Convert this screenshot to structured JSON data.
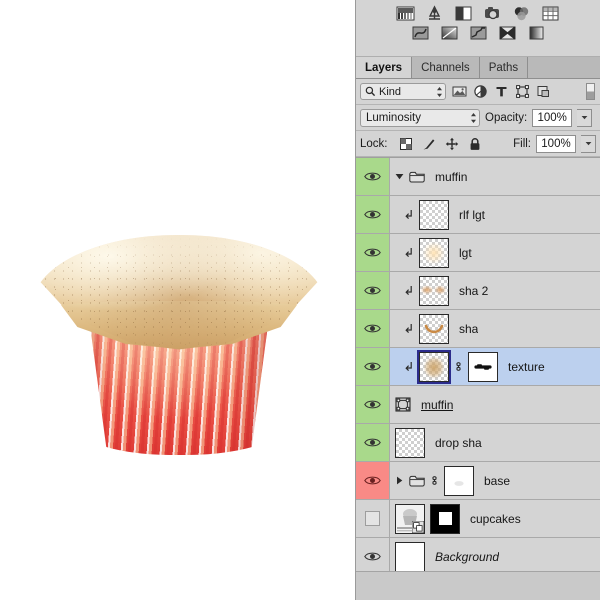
{
  "panel": {
    "adjustments": {
      "row1": [
        {
          "name": "brightness-contrast-icon",
          "title": "Brightness/Contrast"
        },
        {
          "name": "levels-icon",
          "title": "Levels"
        },
        {
          "name": "curves-icon",
          "title": "Curves"
        },
        {
          "name": "exposure-icon",
          "title": "Exposure"
        },
        {
          "name": "vibrance-icon",
          "title": "Vibrance"
        },
        {
          "name": "hue-saturation-icon",
          "title": "Hue/Saturation"
        }
      ],
      "row2": [
        {
          "name": "color-balance-icon",
          "title": "Color Balance"
        },
        {
          "name": "black-white-icon",
          "title": "Black & White"
        },
        {
          "name": "photo-filter-icon",
          "title": "Photo Filter"
        },
        {
          "name": "channel-mixer-icon",
          "title": "Channel Mixer"
        },
        {
          "name": "gradient-map-icon",
          "title": "Gradient Map"
        }
      ]
    },
    "tabs": [
      {
        "label": "Layers",
        "active": true
      },
      {
        "label": "Channels",
        "active": false
      },
      {
        "label": "Paths",
        "active": false
      }
    ],
    "filter": {
      "search_icon": "search-icon",
      "kind_label": "Kind",
      "type_filters": [
        {
          "name": "filter-pixel-icon"
        },
        {
          "name": "filter-adjustment-icon"
        },
        {
          "name": "filter-type-icon"
        },
        {
          "name": "filter-shape-icon"
        },
        {
          "name": "filter-smartobject-icon"
        }
      ],
      "toggle_name": "filter-enable-toggle"
    },
    "options": {
      "blend_mode": "Luminosity",
      "opacity_label": "Opacity:",
      "opacity_value": "100%",
      "lock_label": "Lock:",
      "lock_icons": [
        {
          "name": "lock-transparent-pixels-icon"
        },
        {
          "name": "lock-image-pixels-icon"
        },
        {
          "name": "lock-position-icon"
        },
        {
          "name": "lock-all-icon"
        }
      ],
      "fill_label": "Fill:",
      "fill_value": "100%"
    },
    "layers": [
      {
        "name": "muffin",
        "type": "group",
        "visible": true,
        "eye_state": "on",
        "expanded": true,
        "selected": false,
        "indent": 0,
        "has_thumb": false,
        "clipped": false,
        "underline": false,
        "italic": false
      },
      {
        "name": "rlf lgt",
        "type": "pixel",
        "visible": true,
        "eye_state": "on",
        "selected": false,
        "indent": 1,
        "has_thumb": true,
        "thumb_kind": "empty",
        "clipped": true,
        "underline": false,
        "italic": false
      },
      {
        "name": "lgt",
        "type": "pixel",
        "visible": true,
        "eye_state": "on",
        "selected": false,
        "indent": 1,
        "has_thumb": true,
        "thumb_kind": "light",
        "clipped": true,
        "underline": false,
        "italic": false
      },
      {
        "name": "sha 2",
        "type": "pixel",
        "visible": true,
        "eye_state": "on",
        "selected": false,
        "indent": 1,
        "has_thumb": true,
        "thumb_kind": "shadow2",
        "clipped": true,
        "underline": false,
        "italic": false
      },
      {
        "name": "sha",
        "type": "pixel",
        "visible": true,
        "eye_state": "on",
        "selected": false,
        "indent": 1,
        "has_thumb": true,
        "thumb_kind": "shadow",
        "clipped": true,
        "underline": false,
        "italic": false
      },
      {
        "name": "texture",
        "type": "pixel",
        "visible": true,
        "eye_state": "on",
        "selected": true,
        "indent": 1,
        "has_thumb": true,
        "thumb_kind": "texture",
        "clipped": true,
        "linked_mask": true,
        "mask_kind": "white-strokes",
        "underline": false,
        "italic": false
      },
      {
        "name": "muffin",
        "type": "shape",
        "visible": true,
        "eye_state": "on",
        "selected": false,
        "indent": 0,
        "has_thumb": false,
        "vector_icon": true,
        "clipped": false,
        "underline": true,
        "italic": false
      },
      {
        "name": "drop sha",
        "type": "pixel",
        "visible": true,
        "eye_state": "on",
        "selected": false,
        "indent": 0,
        "has_thumb": true,
        "thumb_kind": "empty",
        "clipped": false,
        "underline": false,
        "italic": false
      },
      {
        "name": "base",
        "type": "group",
        "visible": false,
        "eye_state": "highlight-red",
        "expanded": false,
        "selected": false,
        "indent": 0,
        "has_thumb": true,
        "thumb_kind": "base-white",
        "linked_mask": true,
        "clipped": false,
        "underline": false,
        "italic": false
      },
      {
        "name": "cupcakes",
        "type": "smart-object",
        "visible": false,
        "eye_state": "off",
        "selected": false,
        "indent": 0,
        "has_thumb": true,
        "thumb_kind": "cupcakes-photo",
        "mask_kind": "black-with-white-square",
        "clipped": false,
        "underline": false,
        "italic": false
      },
      {
        "name": "Background",
        "type": "background",
        "visible": true,
        "eye_state": "on",
        "selected": false,
        "indent": 0,
        "has_thumb": true,
        "thumb_kind": "white",
        "clipped": false,
        "underline": false,
        "italic": true
      }
    ]
  },
  "canvas": {
    "artwork_name": "cupcake-liner-with-muffin-top",
    "colors": {
      "liner_light": "#f7a08e",
      "liner_dark": "#de3a35",
      "crust_light": "#f3e2c4",
      "crust_dark": "#d9b079",
      "background": "#ffffff"
    }
  },
  "theme": {
    "panel_bg": "#d4d4d4",
    "row_selected": "#bcd0ee",
    "eye_on": "#a9d98b",
    "eye_red": "#f98a86",
    "border": "#a9a9a9"
  }
}
